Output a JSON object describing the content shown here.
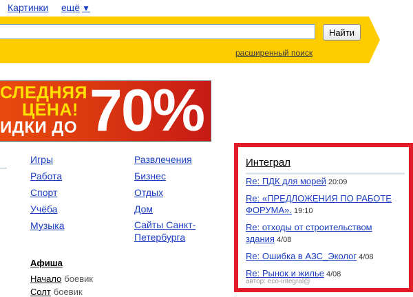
{
  "topnav": {
    "images": "Картинки",
    "more": "ещё",
    "more_arrow": "▼"
  },
  "search": {
    "value": "",
    "button": "Найти",
    "advanced": "расширенный поиск"
  },
  "banner": {
    "line1": "СЛЕДНЯЯ",
    "line2": "ЦЕНА!",
    "line3": "ИДКИ ДО",
    "percent": "70%"
  },
  "categories": {
    "col1": [
      "Игры",
      "Работа",
      "Спорт",
      "Учёба",
      "Музыка"
    ],
    "col2": [
      "Развлечения",
      "Бизнес",
      "Отдых",
      "Дом",
      "Сайты Санкт-Петербурга"
    ]
  },
  "afisha": {
    "title": "Афиша",
    "rows": [
      {
        "name": "Начало",
        "genre": "боевик"
      },
      {
        "name": "Солт",
        "genre": "боевик"
      }
    ]
  },
  "widget": {
    "title": "Интеграл",
    "items": [
      {
        "text": "Re: ПДК для морей",
        "time": "20:09"
      },
      {
        "text": "Re: «ПРЕДЛОЖЕНИЯ ПО РАБОТЕ ФОРУМА».",
        "time": "19:10"
      },
      {
        "text": "Re: отходы от строительством здания",
        "time": "4/08"
      },
      {
        "text": "Re: Ошибка в АЗС_Эколог",
        "time": "4/08"
      },
      {
        "text": "Re: Рынок и жилье",
        "time": "4/08"
      }
    ],
    "author": "автор: eco-integral@"
  },
  "colors": {
    "link": "#1a3dc1",
    "arrow_yellow": "#ffcc00",
    "widget_border": "#e21d28"
  }
}
